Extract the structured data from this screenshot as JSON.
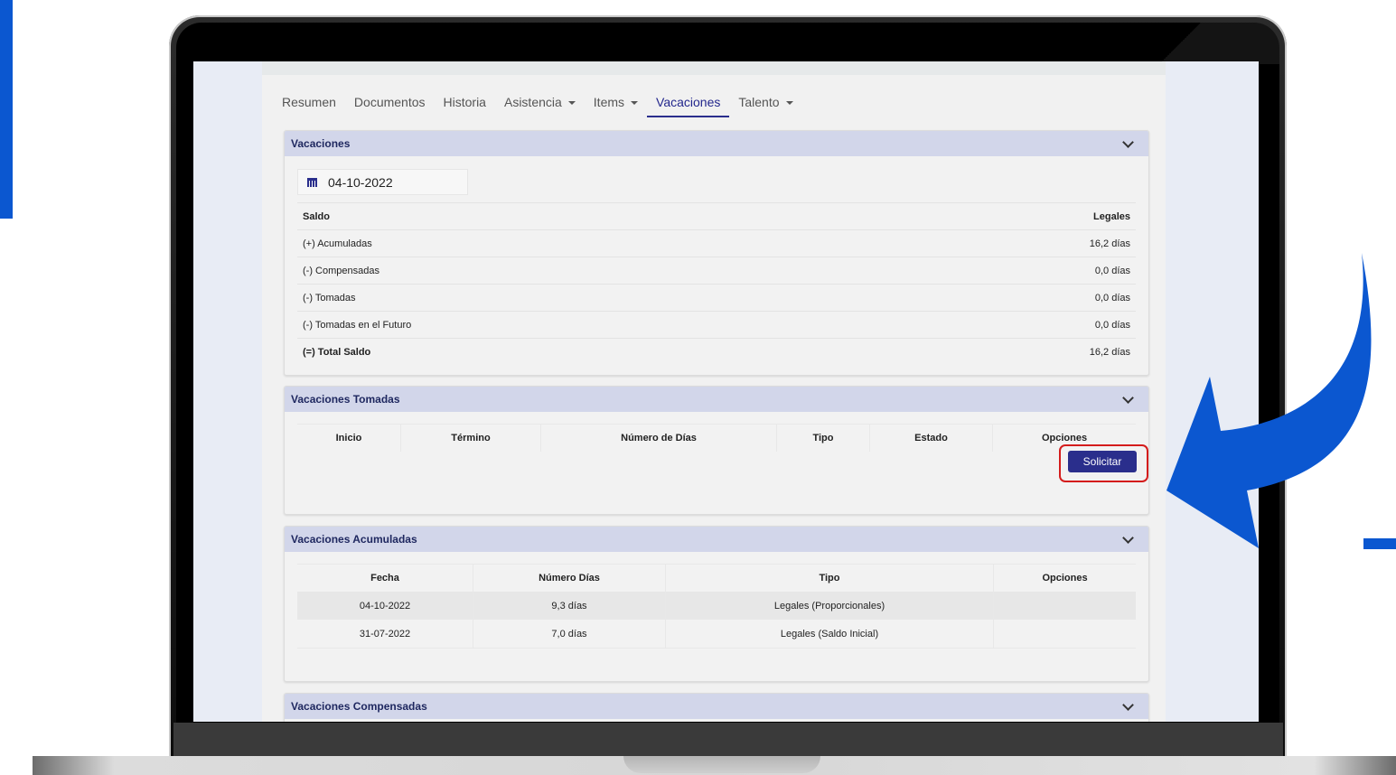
{
  "tabs": [
    {
      "label": "Resumen",
      "dropdown": false,
      "active": false
    },
    {
      "label": "Documentos",
      "dropdown": false,
      "active": false
    },
    {
      "label": "Historia",
      "dropdown": false,
      "active": false
    },
    {
      "label": "Asistencia",
      "dropdown": true,
      "active": false
    },
    {
      "label": "Items",
      "dropdown": true,
      "active": false
    },
    {
      "label": "Vacaciones",
      "dropdown": false,
      "active": true
    },
    {
      "label": "Talento",
      "dropdown": true,
      "active": false
    }
  ],
  "vacaciones": {
    "title": "Vacaciones",
    "date": "04-10-2022",
    "header": {
      "left": "Saldo",
      "right": "Legales"
    },
    "rows": [
      {
        "label": "(+) Acumuladas",
        "value": "16,2 días"
      },
      {
        "label": "(-) Compensadas",
        "value": "0,0 días"
      },
      {
        "label": "(-) Tomadas",
        "value": "0,0 días"
      },
      {
        "label": "(-) Tomadas en el Futuro",
        "value": "0,0 días"
      },
      {
        "label": "(=) Total Saldo",
        "value": "16,2 días"
      }
    ]
  },
  "tomadas": {
    "title": "Vacaciones Tomadas",
    "columns": [
      "Inicio",
      "Término",
      "Número de Días",
      "Tipo",
      "Estado",
      "Opciones"
    ],
    "button": "Solicitar"
  },
  "acumuladas": {
    "title": "Vacaciones Acumuladas",
    "columns": [
      "Fecha",
      "Número Días",
      "Tipo",
      "Opciones"
    ],
    "rows": [
      [
        "04-10-2022",
        "9,3 días",
        "Legales (Proporcionales)",
        ""
      ],
      [
        "31-07-2022",
        "7,0 días",
        "Legales (Saldo Inicial)",
        ""
      ]
    ]
  },
  "compensadas": {
    "title": "Vacaciones Compensadas"
  },
  "colors": {
    "accent": "#2a2e8c",
    "panel_header": "#d2d6ea",
    "highlight": "#d41c1c",
    "arrow": "#0B57D0"
  },
  "icons": [
    "calendar-icon",
    "chevron-down-icon",
    "caret-down-icon"
  ]
}
